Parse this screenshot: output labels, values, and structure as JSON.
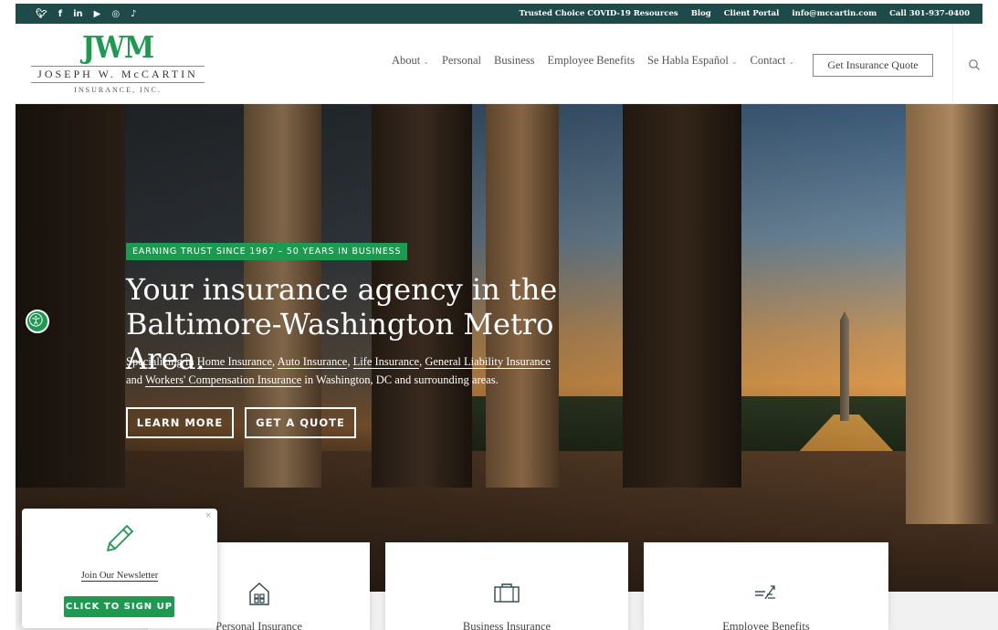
{
  "topbar": {
    "social": [
      {
        "name": "twitter-icon",
        "glyph": "🐦︎"
      },
      {
        "name": "facebook-icon",
        "glyph": "f"
      },
      {
        "name": "linkedin-icon",
        "glyph": "in"
      },
      {
        "name": "youtube-icon",
        "glyph": "▶"
      },
      {
        "name": "instagram-icon",
        "glyph": "◎"
      },
      {
        "name": "tiktok-icon",
        "glyph": "♪"
      }
    ],
    "links": [
      "Trusted Choice COVID-19 Resources",
      "Blog",
      "Client Portal",
      "info@mccartin.com",
      "Call 301-937-0400"
    ]
  },
  "logo": {
    "mark": "JWM",
    "name": "JOSEPH W. McCARTIN",
    "sub": "INSURANCE, INC."
  },
  "nav": {
    "items": [
      {
        "label": "About",
        "dropdown": true
      },
      {
        "label": "Personal",
        "dropdown": false
      },
      {
        "label": "Business",
        "dropdown": false
      },
      {
        "label": "Employee Benefits",
        "dropdown": false
      },
      {
        "label": "Se Habla Español",
        "dropdown": true
      },
      {
        "label": "Contact",
        "dropdown": true
      }
    ],
    "quote_button": "Get Insurance Quote"
  },
  "hero": {
    "badge": "EARNING TRUST SINCE 1967 – 50 YEARS IN BUSINESS",
    "headline_line1": "Your insurance agency in the",
    "headline_line2": "Baltimore-Washington Metro Area.",
    "para_prefix": "Specializing in ",
    "links": [
      "Home Insurance",
      "Auto Insurance",
      "Life Insurance",
      "General Liability Insurance",
      "Workers' Compensation Insurance"
    ],
    "para_and": "and ",
    "para_suffix": " in Washington, DC and surrounding areas.",
    "learn_more": "LEARN MORE",
    "get_quote": "GET A QUOTE"
  },
  "cards": [
    {
      "label": "Personal Insurance",
      "icon": "house-icon"
    },
    {
      "label": "Business Insurance",
      "icon": "briefcase-icon"
    },
    {
      "label": "Employee Benefits",
      "icon": "benefits-icon"
    }
  ],
  "popup": {
    "close": "×",
    "text": "Join Our Newsletter",
    "button": "CLICK TO SIGN UP"
  },
  "colors": {
    "brand_green": "#1d9a4f",
    "topbar": "#1f4a4a"
  }
}
